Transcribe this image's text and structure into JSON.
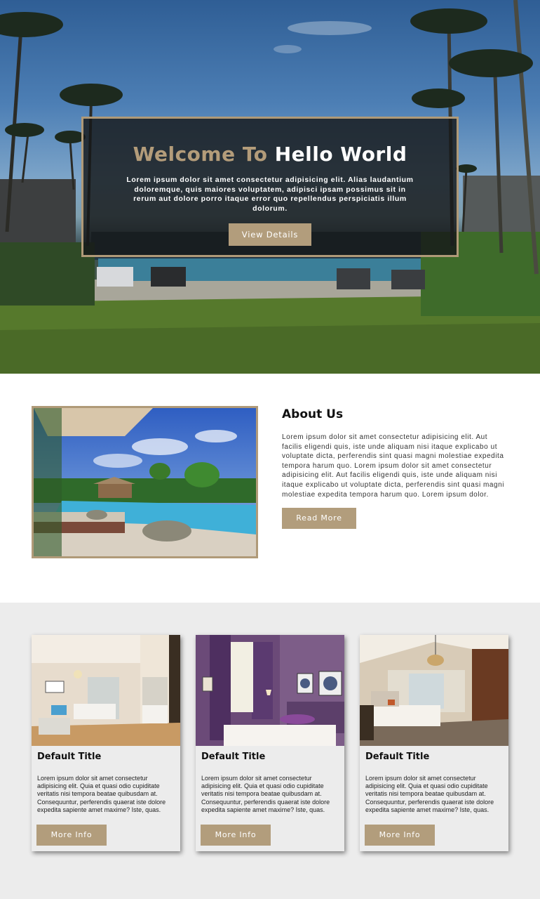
{
  "hero": {
    "title_part1": "Welcome To",
    "title_part2": "Hello World",
    "text": "Lorem ipsum dolor sit amet consectetur adipisicing elit. Alias laudantium doloremque, quis maiores voluptatem, adipisci ipsam possimus sit in rerum aut dolore porro itaque error quo repellendus perspiciatis illum dolorum.",
    "button_label": "View Details"
  },
  "about": {
    "title": "About Us",
    "text": "Lorem ipsum dolor sit amet consectetur adipisicing elit. Aut facilis eligendi quis, iste unde aliquam nisi itaque explicabo ut voluptate dicta, perferendis sint quasi magni molestiae expedita tempora harum quo. Lorem ipsum dolor sit amet consectetur adipisicing elit. Aut facilis eligendi quis, iste unde aliquam nisi itaque explicabo ut voluptate dicta, perferendis sint quasi magni molestiae expedita tempora harum quo. Lorem ipsum dolor.",
    "button_label": "Read More"
  },
  "cards": [
    {
      "title": "Default Title",
      "text": "Lorem ipsum dolor sit amet consectetur adipisicing elit. Quia et quasi odio cupiditate veritatis nisi tempora beatae quibusdam at. Consequuntur, perferendis quaerat iste dolore expedita sapiente amet maxime? Iste, quas.",
      "button_label": "More Info"
    },
    {
      "title": "Default Title",
      "text": "Lorem ipsum dolor sit amet consectetur adipisicing elit. Quia et quasi odio cupiditate veritatis nisi tempora beatae quibusdam at. Consequuntur, perferendis quaerat iste dolore expedita sapiente amet maxime? Iste, quas.",
      "button_label": "More Info"
    },
    {
      "title": "Default Title",
      "text": "Lorem ipsum dolor sit amet consectetur adipisicing elit. Quia et quasi odio cupiditate veritatis nisi tempora beatae quibusdam at. Consequuntur, perferendis quaerat iste dolore expedita sapiente amet maxime? Iste, quas.",
      "button_label": "More Info"
    }
  ],
  "colors": {
    "accent_tan": "#b29d7c",
    "hero_overlay": "#16181a",
    "section_gray": "#ececec"
  }
}
